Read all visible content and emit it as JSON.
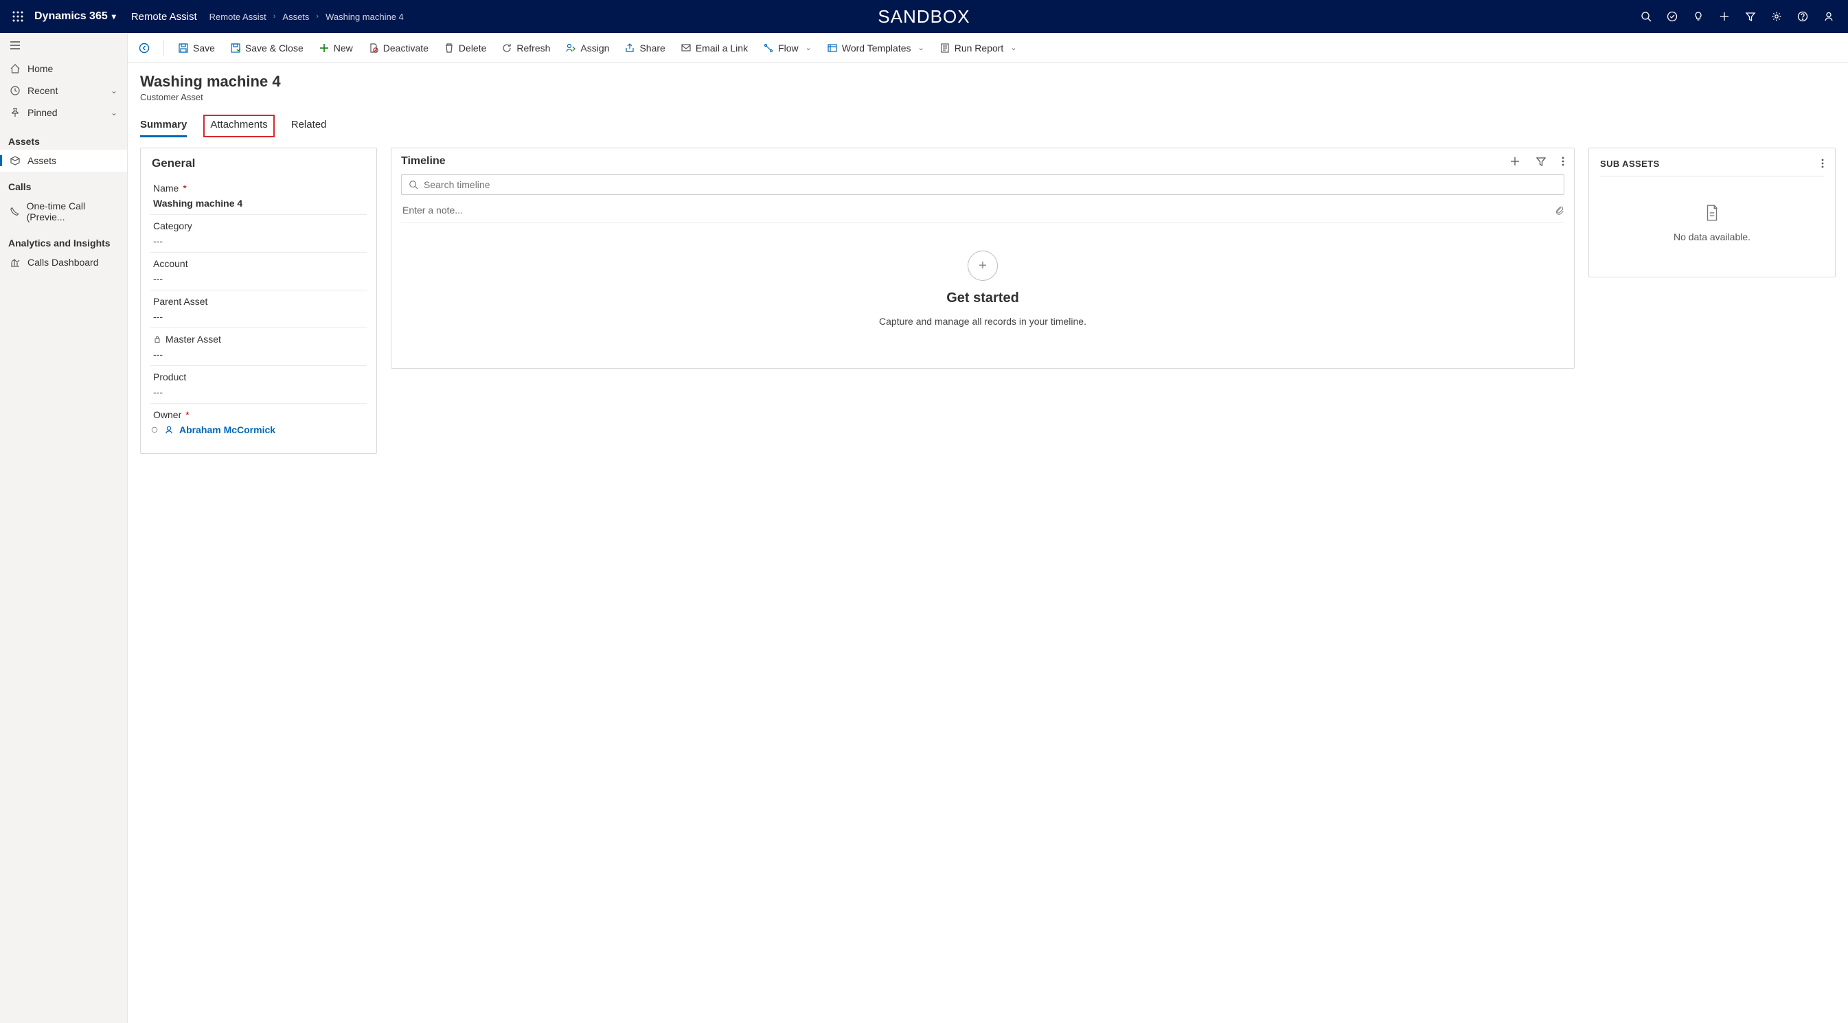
{
  "topbar": {
    "brand": "Dynamics 365",
    "app": "Remote Assist",
    "center": "SANDBOX",
    "breadcrumbs": [
      "Remote Assist",
      "Assets",
      "Washing machine 4"
    ]
  },
  "sidebar": {
    "home": "Home",
    "recent": "Recent",
    "pinned": "Pinned",
    "groups": {
      "assets": {
        "label": "Assets",
        "items": [
          "Assets"
        ]
      },
      "calls": {
        "label": "Calls",
        "items": [
          "One-time Call (Previe..."
        ]
      },
      "analytics": {
        "label": "Analytics and Insights",
        "items": [
          "Calls Dashboard"
        ]
      }
    }
  },
  "commands": {
    "save": "Save",
    "save_close": "Save & Close",
    "new": "New",
    "deactivate": "Deactivate",
    "delete": "Delete",
    "refresh": "Refresh",
    "assign": "Assign",
    "share": "Share",
    "email": "Email a Link",
    "flow": "Flow",
    "templates": "Word Templates",
    "report": "Run Report"
  },
  "page": {
    "title": "Washing machine  4",
    "subtitle": "Customer Asset",
    "tabs": {
      "summary": "Summary",
      "attachments": "Attachments",
      "related": "Related"
    }
  },
  "general": {
    "title": "General",
    "fields": {
      "name": {
        "label": "Name",
        "value": "Washing machine  4",
        "required": true
      },
      "category": {
        "label": "Category",
        "value": "---"
      },
      "account": {
        "label": "Account",
        "value": "---"
      },
      "parent": {
        "label": "Parent Asset",
        "value": "---"
      },
      "master": {
        "label": "Master Asset",
        "value": "---",
        "locked": true
      },
      "product": {
        "label": "Product",
        "value": "---"
      },
      "owner": {
        "label": "Owner",
        "value": "Abraham McCormick",
        "required": true
      }
    }
  },
  "timeline": {
    "title": "Timeline",
    "search_placeholder": "Search timeline",
    "note_placeholder": "Enter a note...",
    "empty_title": "Get started",
    "empty_sub": "Capture and manage all records in your timeline."
  },
  "subassets": {
    "title": "SUB ASSETS",
    "nodata": "No data available."
  }
}
